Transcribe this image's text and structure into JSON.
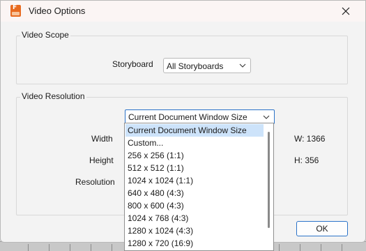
{
  "window": {
    "title": "Video Options",
    "close_icon": "close-icon",
    "app_icon": "app-icon"
  },
  "video_scope": {
    "group_label": "Video Scope",
    "storyboard_label": "Storyboard",
    "storyboard_value": "All Storyboards"
  },
  "video_resolution": {
    "group_label": "Video Resolution",
    "size_value": "Current Document Window Size",
    "width_label": "Width",
    "height_label": "Height",
    "resolution_label": "Resolution",
    "w_readout": "W: 1366",
    "h_readout": "H: 356",
    "dropdown_options": [
      "Current Document Window Size",
      "Custom...",
      "256 x 256 (1:1)",
      "512 x 512 (1:1)",
      "1024 x 1024 (1:1)",
      "640 x 480 (4:3)",
      "800 x 600 (4:3)",
      "1024 x 768 (4:3)",
      "1280 x 1024 (4:3)",
      "1280 x 720 (16:9)"
    ],
    "selected_index": 0
  },
  "buttons": {
    "ok_label": "OK"
  },
  "colors": {
    "accent": "#2a72c8",
    "selection": "#cde3fa",
    "app_icon": "#e86a1f"
  }
}
